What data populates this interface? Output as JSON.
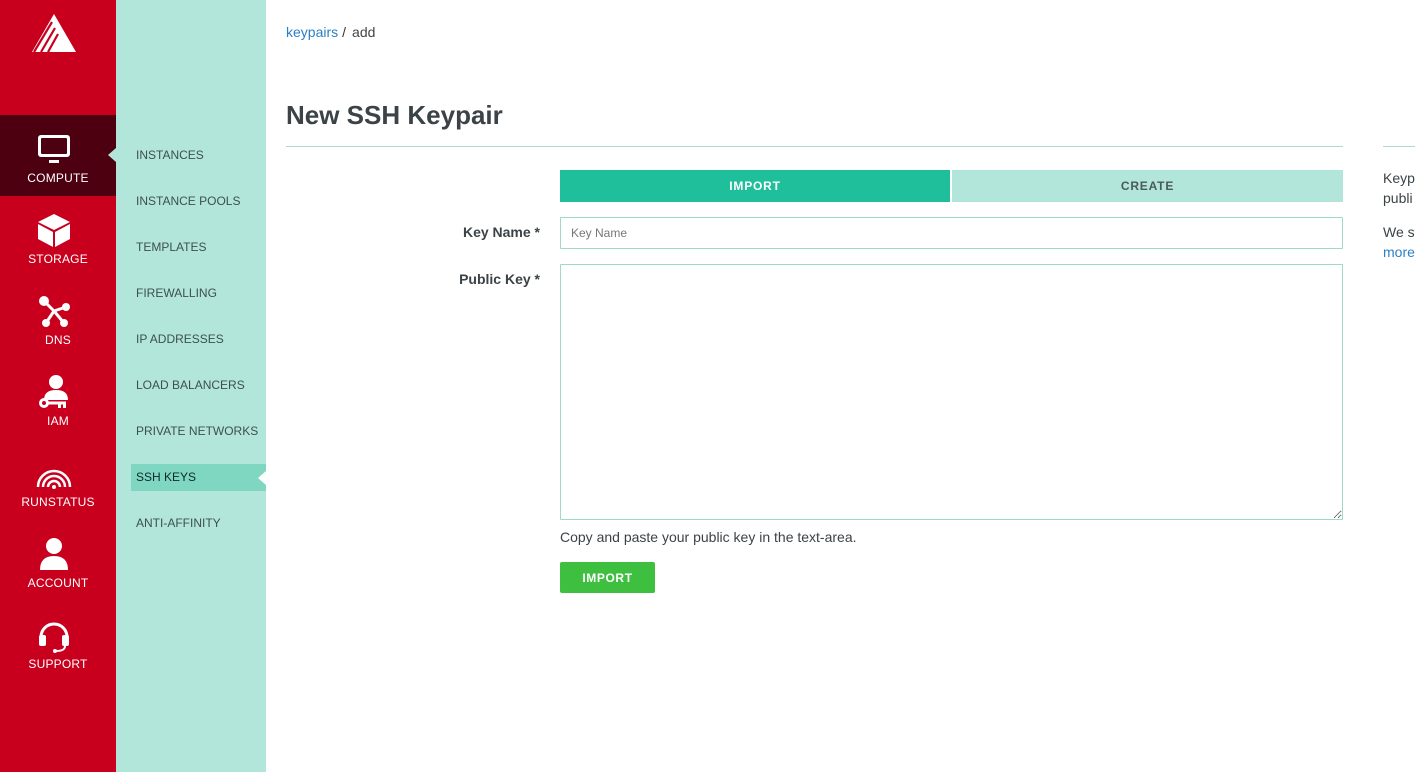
{
  "nav_primary": [
    {
      "label": "COMPUTE",
      "icon": "monitor-icon",
      "active": true
    },
    {
      "label": "STORAGE",
      "icon": "cube-icon"
    },
    {
      "label": "DNS",
      "icon": "network-nodes-icon"
    },
    {
      "label": "IAM",
      "icon": "user-key-icon"
    },
    {
      "label": "RUNSTATUS",
      "icon": "signal-waves-icon"
    },
    {
      "label": "ACCOUNT",
      "icon": "user-icon"
    },
    {
      "label": "SUPPORT",
      "icon": "headset-icon"
    }
  ],
  "nav_secondary": [
    {
      "label": "INSTANCES"
    },
    {
      "label": "INSTANCE POOLS"
    },
    {
      "label": "TEMPLATES"
    },
    {
      "label": "FIREWALLING"
    },
    {
      "label": "IP ADDRESSES"
    },
    {
      "label": "LOAD BALANCERS"
    },
    {
      "label": "PRIVATE NETWORKS"
    },
    {
      "label": "SSH KEYS",
      "active": true
    },
    {
      "label": "ANTI-AFFINITY"
    }
  ],
  "breadcrumb": {
    "parent": "keypairs",
    "separator": "/",
    "current": "add"
  },
  "page": {
    "title": "New SSH Keypair"
  },
  "tabs": {
    "import": "IMPORT",
    "create": "CREATE"
  },
  "form": {
    "key_name_label": "Key Name *",
    "key_name_placeholder": "Key Name",
    "key_name_value": "",
    "public_key_label": "Public Key *",
    "public_key_value": "",
    "help": "Copy and paste your public key in the text-area.",
    "submit": "IMPORT"
  },
  "aside": {
    "line1": "Keyp",
    "line2": "publi",
    "line3": "We st",
    "link": "more"
  },
  "colors": {
    "brand_red": "#c8001e",
    "active_dark": "#4c0010",
    "mint": "#b2e6da",
    "teal": "#1fbf9c",
    "green_button": "#3fbf3f",
    "link": "#2b7fc4"
  }
}
